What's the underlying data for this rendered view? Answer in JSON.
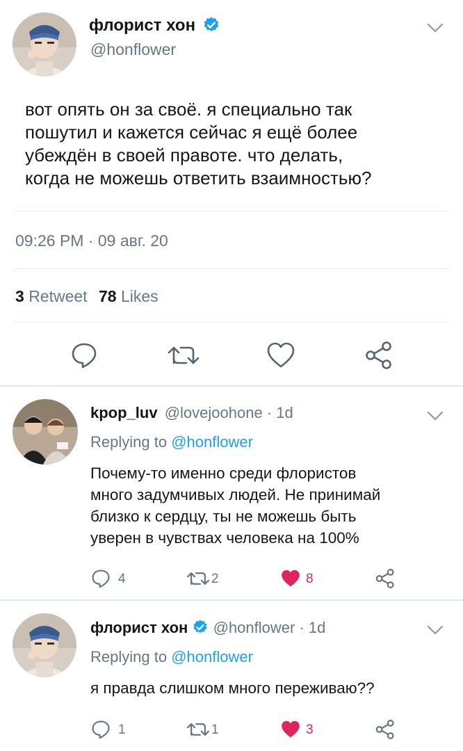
{
  "main_tweet": {
    "display_name": "флорист хон",
    "handle": "@honflower",
    "text_lines": [
      "вот опять он за своё. я специально так",
      "пошутил и кажется сейчас я ещё более",
      "убеждён в своей правоте. что делать,",
      "когда не можешь ответить взаимностью?"
    ],
    "timestamp": "09:26 PM · 09 авг. 20",
    "retweet_count": "3",
    "retweet_label": "Retweet",
    "likes_count": "78",
    "likes_label": "Likes",
    "actions": [
      "reply-icon",
      "retweet-icon",
      "like-icon",
      "share-icon"
    ]
  },
  "replies": [
    {
      "display_name": "kpop_luv",
      "handle": "@lovejoohone",
      "time": "· 1d",
      "replying_prefix": "Replying to",
      "replying_to": "@honflower",
      "text_lines": [
        "Почему-то именно среди флористов",
        "много задумчивых людей. Не принимай",
        "близко к сердцу, ты не можешь быть",
        "уверен в чувствах человека на 100%"
      ],
      "reply_count": "4",
      "retweet_count": "2",
      "like_count": "8",
      "liked": true
    },
    {
      "display_name": "флорист хон",
      "handle": "@honflower",
      "time": "· 1d",
      "replying_prefix": "Replying to",
      "replying_to": "@honflower",
      "text_lines": [
        "я правда слишком много переживаю??"
      ],
      "reply_count": "1",
      "retweet_count": "1",
      "like_count": "3",
      "liked": true
    }
  ],
  "colors": {
    "link": "#1da1f2",
    "like": "#e0245e",
    "secondary": "#657786",
    "divider": "#e6ecf0"
  }
}
